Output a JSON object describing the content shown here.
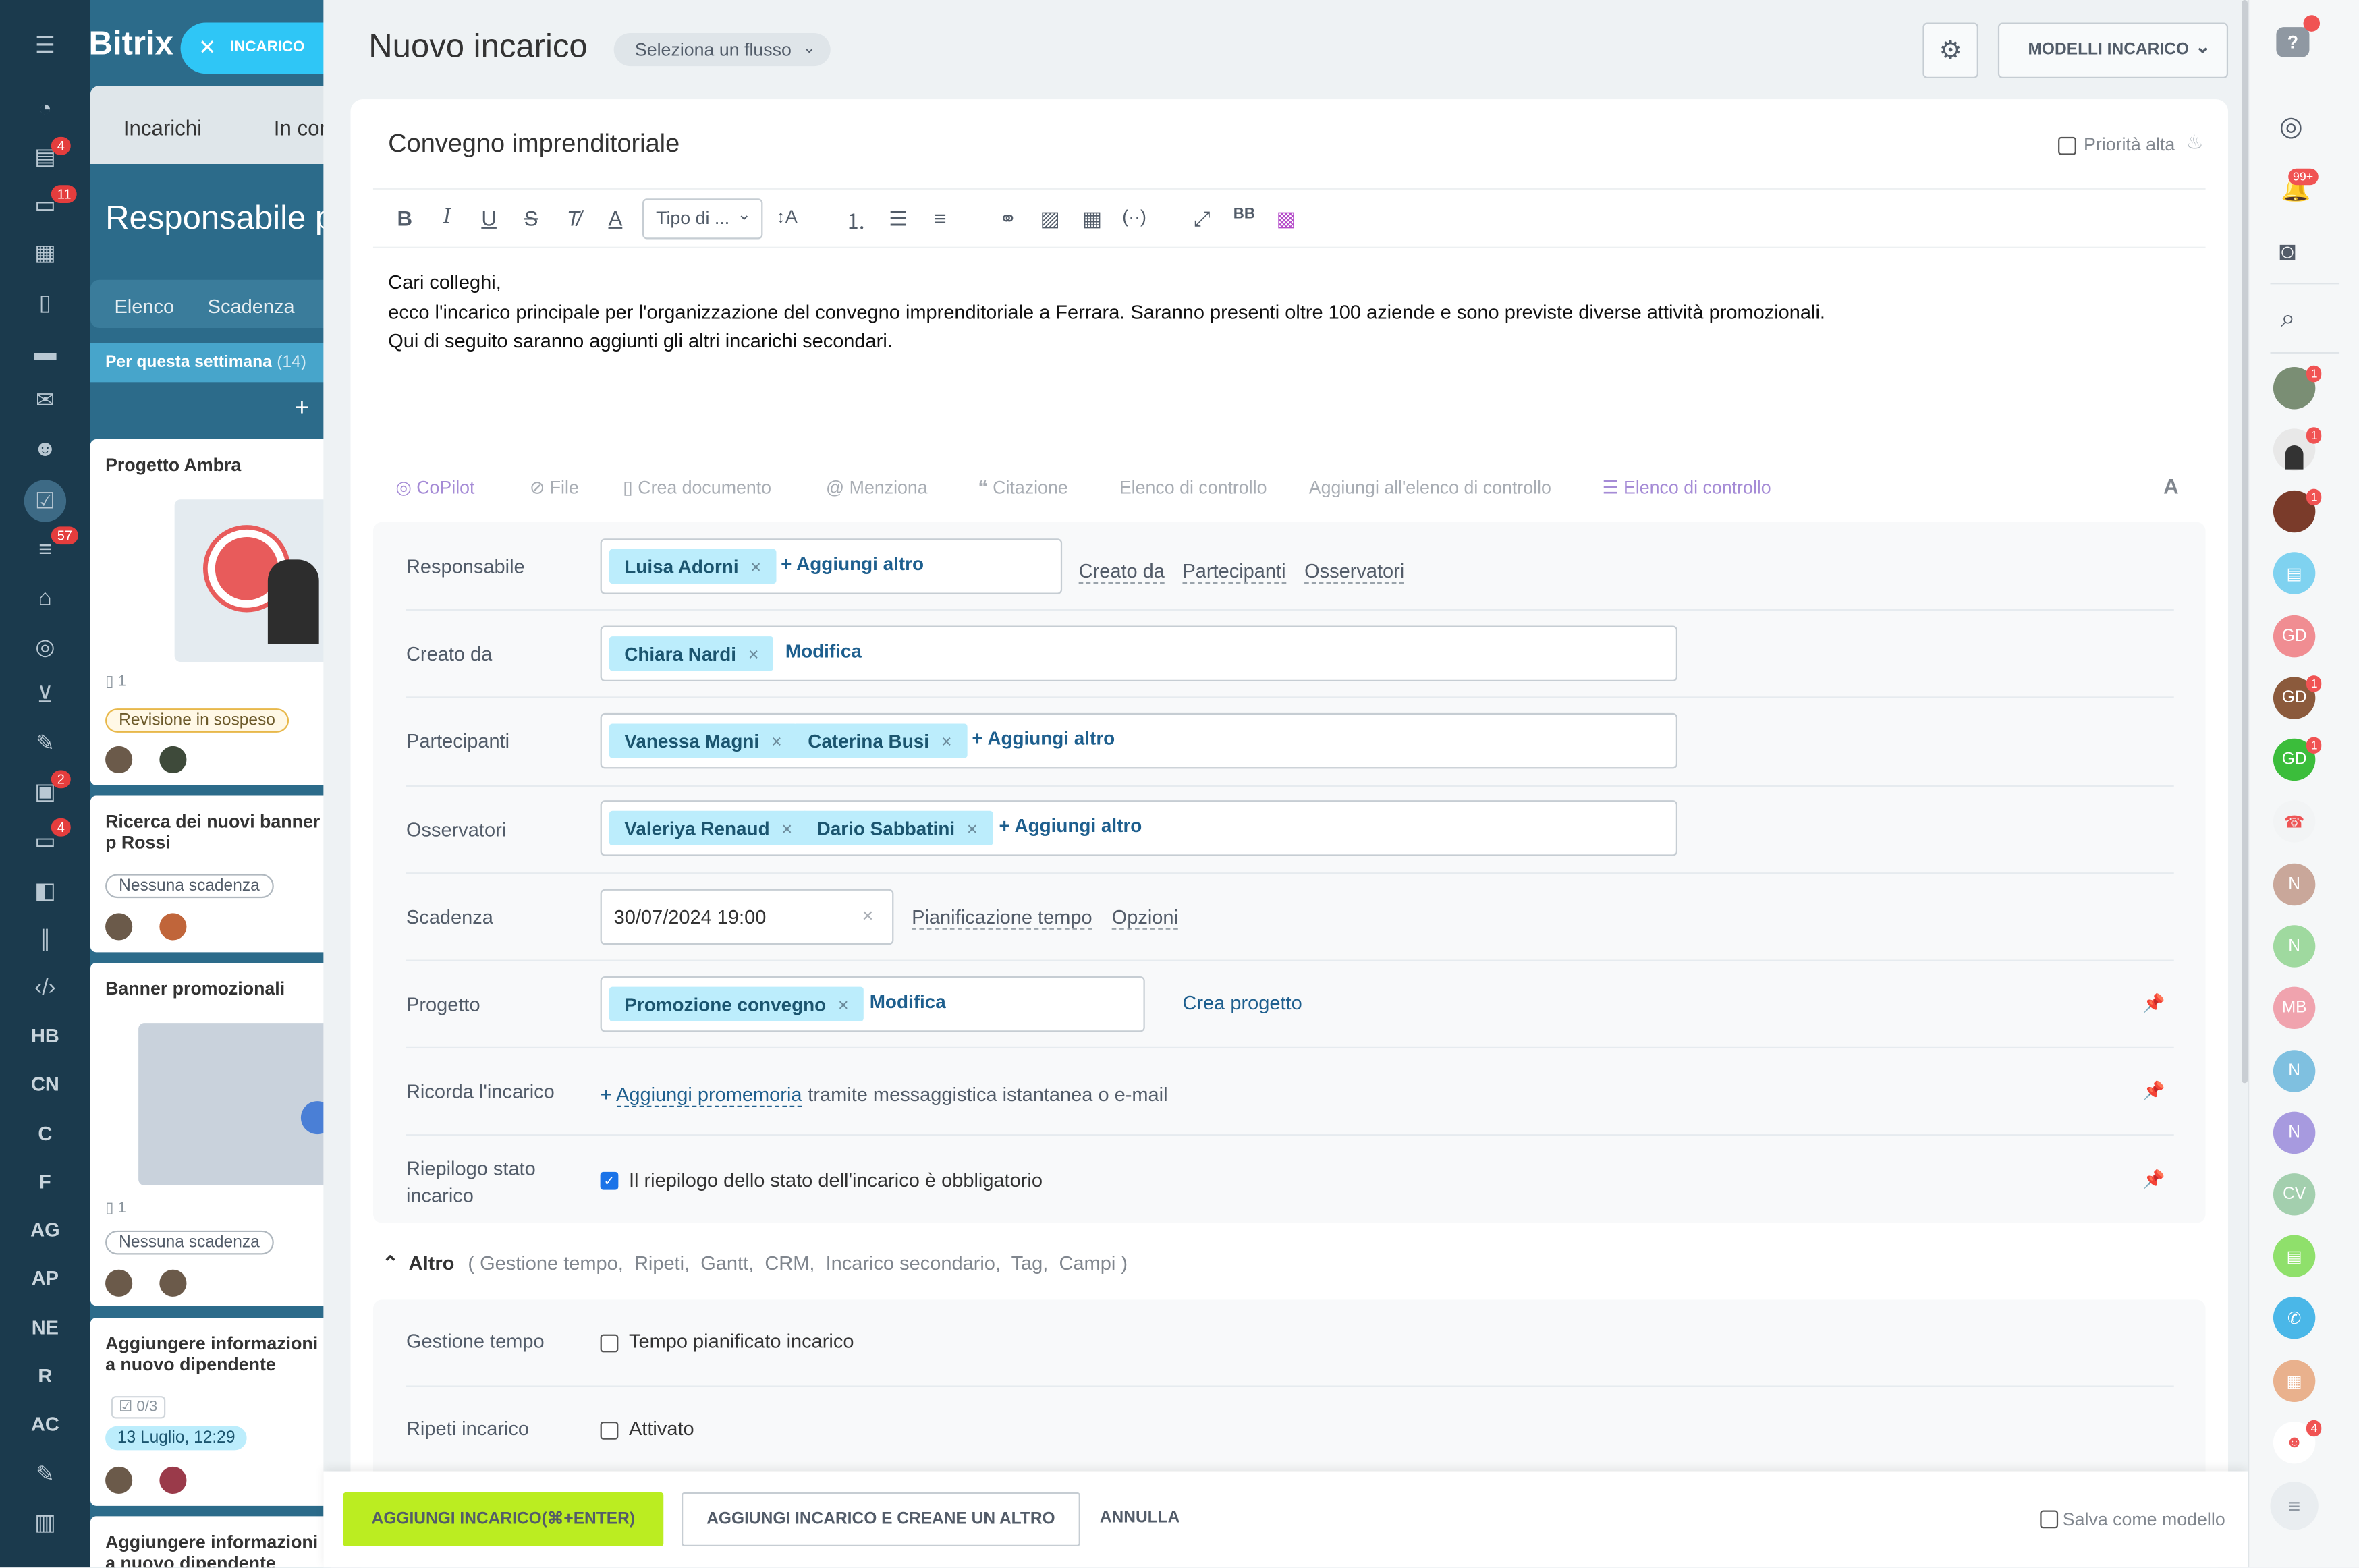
{
  "left_nav": {
    "badges": [
      "4",
      "11",
      "57",
      "2",
      "4"
    ],
    "text_items": [
      "HB",
      "CN",
      "C",
      "F",
      "AG",
      "AP",
      "NE",
      "R",
      "AC"
    ]
  },
  "background_app": {
    "logo": "Bitrix",
    "tabs": [
      "Incarichi",
      "In cor"
    ],
    "heading": "Responsabile p",
    "view_tabs": [
      "Elenco",
      "Scadenza"
    ],
    "column_title": "Per questa settimana",
    "column_count": "(14)",
    "cards": [
      {
        "title": "Progetto Ambra",
        "meta": "1",
        "badge": "Revisione in sospeso"
      },
      {
        "title": "Ricerca dei nuovi banner p Rossi",
        "badge": "Nessuna scadenza"
      },
      {
        "title": "Banner promozionali",
        "meta": "1",
        "badge": "Nessuna scadenza"
      },
      {
        "title": "Aggiungere informazioni a nuovo dipendente",
        "meta": "0/3",
        "badge": "13 Luglio, 12:29"
      },
      {
        "title": "Aggiungere informazioni a nuovo dipendente"
      }
    ]
  },
  "close_tab": {
    "label": "INCARICO"
  },
  "header": {
    "title": "Nuovo incarico",
    "flow_select": "Seleziona un flusso",
    "templates_button": "MODELLI INCARICO"
  },
  "task": {
    "title": "Convegno imprenditoriale",
    "high_priority_label": "Priorità alta",
    "text_style_select": "Tipo di ...",
    "body_lines": [
      "Cari colleghi,",
      "ecco l'incarico principale per l'organizzazione del convegno imprenditoriale a Ferrara. Saranno presenti oltre 100 aziende e sono previste diverse attività promozionali.",
      "Qui di seguito saranno aggiunti gli altri incarichi secondari."
    ]
  },
  "action_bar": {
    "copilot": "CoPilot",
    "file": "File",
    "create_doc": "Crea documento",
    "mention": "Menziona",
    "quote": "Citazione",
    "checklist": "Elenco di controllo",
    "add_to_checklist": "Aggiungi all'elenco di controllo",
    "checklist2": "Elenco di controllo",
    "font_letter": "A"
  },
  "fields": {
    "responsible": {
      "label": "Responsabile",
      "chips": [
        "Luisa Adorni"
      ],
      "add": "Aggiungi altro",
      "links": [
        "Creato da",
        "Partecipanti",
        "Osservatori"
      ]
    },
    "created_by": {
      "label": "Creato da",
      "chips": [
        "Chiara Nardi"
      ],
      "action": "Modifica"
    },
    "participants": {
      "label": "Partecipanti",
      "chips": [
        "Vanessa Magni",
        "Caterina Busi"
      ],
      "add": "Aggiungi altro"
    },
    "observers": {
      "label": "Osservatori",
      "chips": [
        "Valeriya Renaud",
        "Dario Sabbatini"
      ],
      "add": "Aggiungi altro"
    },
    "deadline": {
      "label": "Scadenza",
      "value": "30/07/2024 19:00",
      "links": [
        "Pianificazione tempo",
        "Opzioni"
      ]
    },
    "project": {
      "label": "Progetto",
      "chips": [
        "Promozione convegno"
      ],
      "action": "Modifica",
      "create": "Crea progetto"
    },
    "reminder": {
      "label": "Ricorda l'incarico",
      "link": "Aggiungi promemoria",
      "suffix": "tramite messaggistica istantanea o e-mail"
    },
    "summary": {
      "label_line1": "Riepilogo stato",
      "label_line2": "incarico",
      "checkbox_label": "Il riepilogo dello stato dell'incarico è obbligatorio",
      "checked": true
    }
  },
  "more": {
    "label": "Altro",
    "items": [
      "Gestione tempo,",
      "Ripeti,",
      "Gantt,",
      "CRM,",
      "Incarico secondario,",
      "Tag,",
      "Campi"
    ],
    "time_management": {
      "label": "Gestione tempo",
      "checkbox_label": "Tempo pianificato incarico"
    },
    "repeat": {
      "label": "Ripeti incarico",
      "checkbox_label": "Attivato"
    }
  },
  "footer": {
    "add_button": "AGGIUNGI INCARICO(⌘+ENTER)",
    "add_another_button": "AGGIUNGI INCARICO E CREANE UN ALTRO",
    "cancel": "ANNULLA",
    "save_template": "Salva come modello"
  },
  "right_bar": {
    "badges": {
      "notifications": "99+",
      "chat1": "1",
      "chat2": "1",
      "chat3": "1",
      "gd": "1",
      "gd2": "1",
      "bottom": "4"
    },
    "avatars": [
      "GD",
      "GD",
      "GD",
      "N",
      "N",
      "MB",
      "N",
      "N",
      "CV"
    ]
  },
  "colors": {
    "accent_green": "#bbed21",
    "chip_bg": "#bcedfc",
    "nav_bg": "#1b3a4d",
    "link": "#1e5f8e"
  }
}
